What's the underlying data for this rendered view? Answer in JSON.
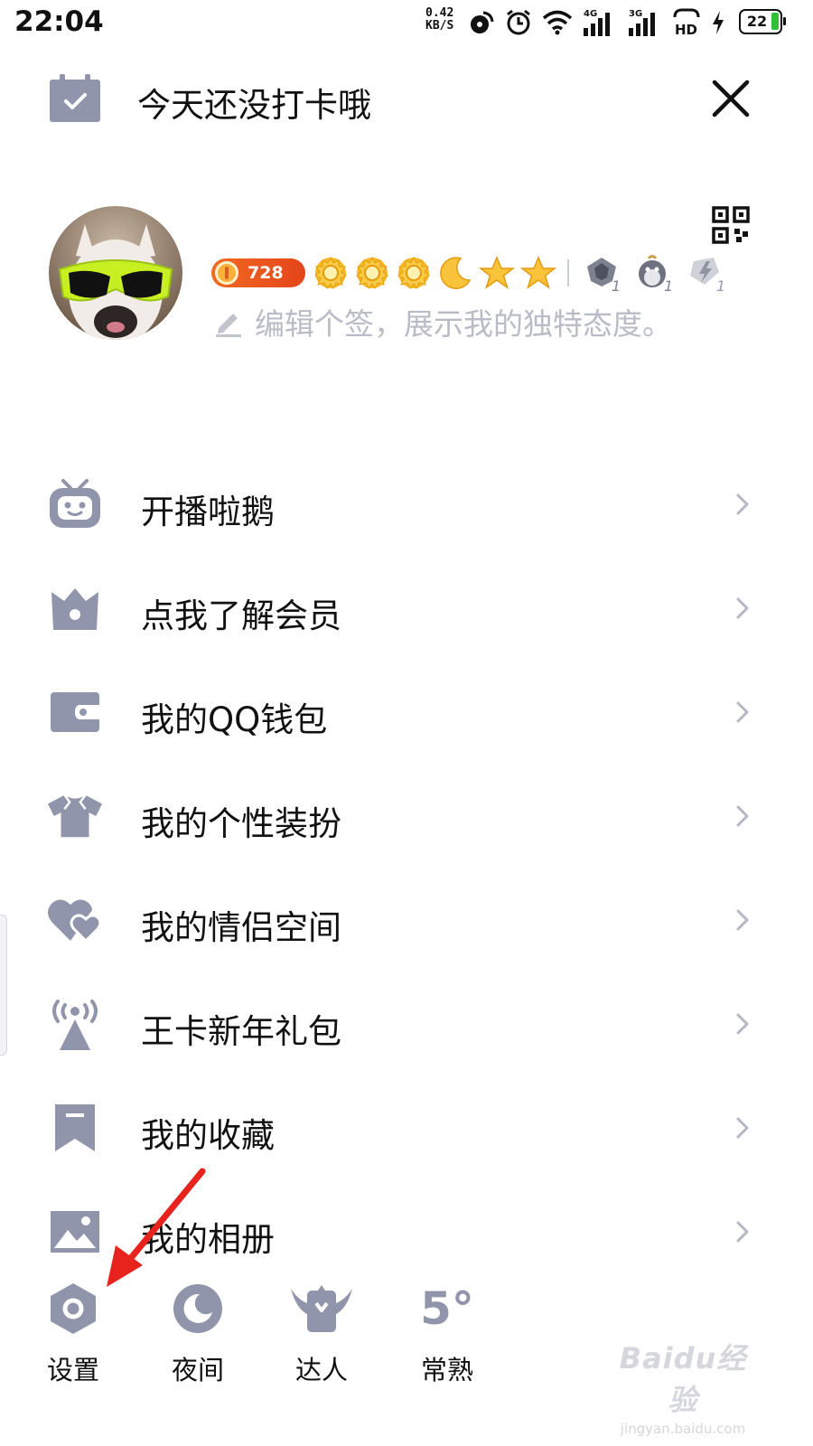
{
  "status_bar": {
    "time": "22:04",
    "network_speed_value": "0.42",
    "network_speed_unit": "KB/S",
    "signal_1_label": "4G",
    "signal_2_label": "3G",
    "hd_label": "HD",
    "battery_level": "22",
    "battery_color": "#2fbf3a",
    "icons": [
      "nfc-icon",
      "alarm-icon",
      "wifi-icon",
      "signal-icon",
      "hd-call-icon",
      "charging-icon",
      "battery-icon"
    ]
  },
  "checkin": {
    "text": "今天还没打卡哦",
    "icon": "calendar-check-icon",
    "close_icon": "close-icon"
  },
  "profile": {
    "avatar_icon": "avatar",
    "qr_icon": "qr-code-icon",
    "vip_score": "728",
    "level_icons": [
      "sun-icon",
      "sun-icon",
      "sun-icon",
      "moon-icon",
      "star-icon",
      "star-icon"
    ],
    "game_badges": [
      {
        "icon": "game-badge-icon",
        "count": "1"
      },
      {
        "icon": "penguin-badge-icon",
        "count": "1"
      },
      {
        "icon": "lightning-badge-icon",
        "count": "1"
      }
    ],
    "signature_placeholder": "编辑个签，展示我的独特态度。",
    "signature_icon": "edit-pencil-icon"
  },
  "menu": {
    "items": [
      {
        "label": "开播啦鹅",
        "icon": "tv-robot-icon"
      },
      {
        "label": "点我了解会员",
        "icon": "crown-icon"
      },
      {
        "label": "我的QQ钱包",
        "icon": "wallet-icon"
      },
      {
        "label": "我的个性装扮",
        "icon": "shirt-icon"
      },
      {
        "label": "我的情侣空间",
        "icon": "hearts-icon"
      },
      {
        "label": "王卡新年礼包",
        "icon": "broadcast-tower-icon"
      },
      {
        "label": "我的收藏",
        "icon": "bookmark-icon"
      },
      {
        "label": "我的相册",
        "icon": "photo-icon"
      }
    ],
    "chevron_icon": "chevron-right-icon"
  },
  "bottom_bar": {
    "settings_label": "设置",
    "night_label": "夜间",
    "expert_label": "达人",
    "weather_temp": "5°",
    "weather_city": "常熟"
  },
  "watermark": {
    "main": "Baidu经验",
    "sub": "jingyan.baidu.com"
  },
  "colors": {
    "icon_gray": "#9195ab",
    "chevron": "#b5b7c2",
    "vip_orange": "#e4451a",
    "arrow_red": "#e8221c",
    "gold": "#f6b824"
  }
}
